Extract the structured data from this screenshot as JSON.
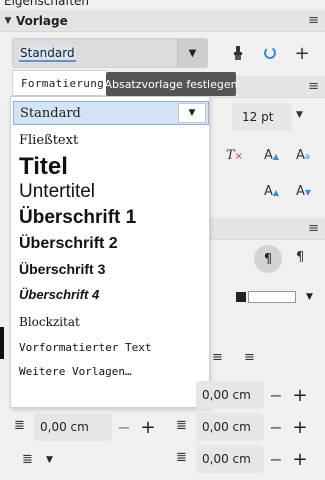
{
  "panel": {
    "title": "Eigenschaften"
  },
  "vorlage": {
    "section_label": "Vorlage",
    "combo_value": "Standard",
    "tooltip": "Absatzvorlage festlegen",
    "formatting_label": "Formatierung"
  },
  "dropdown": {
    "current_value": "Standard",
    "options": [
      "Fließtext",
      "Titel",
      "Untertitel",
      "Überschrift 1",
      "Überschrift 2",
      "Überschrift 3",
      "Überschrift 4",
      "Blockzitat",
      "Vorformatierter Text",
      "Weitere Vorlagen…"
    ]
  },
  "zeichen": {
    "font_size": "12 pt"
  },
  "spacing": {
    "above": "0,00 cm",
    "below": "0,00 cm",
    "indent_before": "0,00 cm",
    "indent_after": "0,00 cm",
    "first_line": "0,00 cm"
  }
}
